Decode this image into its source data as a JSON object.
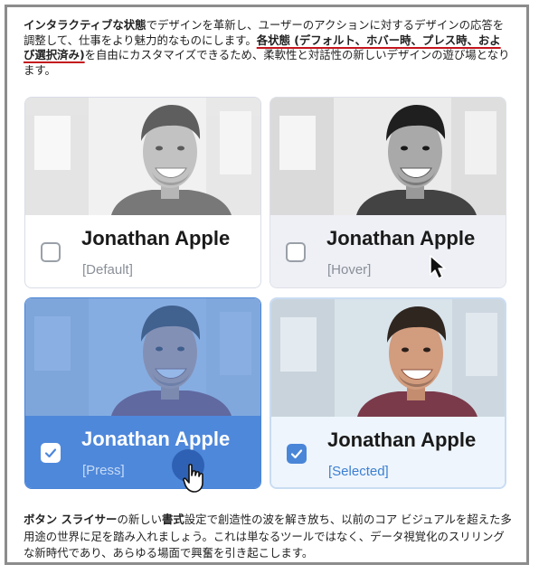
{
  "intro": {
    "p1": "インタラクティブな状態",
    "p2": "でデザインを革新し、ユーザーのアクションに対するデザインの応答を調整して、仕事をより魅力的なものにします。",
    "p3": "各状態 (デフォルト、ホバー時、プレス時、および選択済み)",
    "p4": "を自由にカスタマイズできるため、柔軟性と対話性の新しいデザインの遊び場となります。"
  },
  "cards": [
    {
      "name": "Jonathan Apple",
      "state": "[Default]",
      "checked": false
    },
    {
      "name": "Jonathan Apple",
      "state": "[Hover]",
      "checked": false
    },
    {
      "name": "Jonathan Apple",
      "state": "[Press]",
      "checked": true
    },
    {
      "name": "Jonathan Apple",
      "state": "[Selected]",
      "checked": true
    }
  ],
  "outro": {
    "p1": "ボタン スライサー",
    "p2": "の新しい",
    "p3": "書式",
    "p4": "設定で創造性の波を解き放ち、以前のコア ビジュアルを超えた多用途の世界に足を踏み入れましょう。これは単なるツールではなく、データ視覚化のスリリングな新時代であり、あらゆる場面で興奮を引き起こします。"
  },
  "colors": {
    "press": "#4e88db",
    "selected_bg": "#eef5fd",
    "hover_bg": "#eef0f5",
    "underline": "#c4161c"
  },
  "icons": {
    "check": "checkmark-icon",
    "arrow_cursor": "arrow-cursor-icon",
    "hand_cursor": "hand-cursor-icon"
  }
}
